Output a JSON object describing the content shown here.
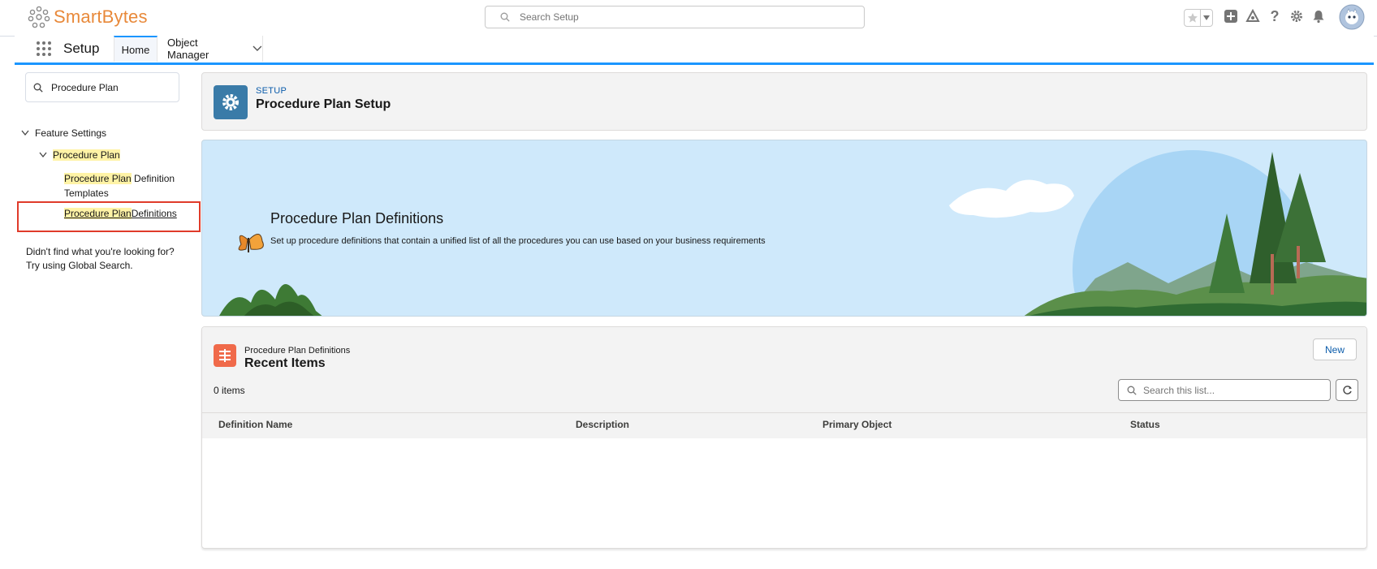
{
  "header": {
    "logo_text": "SmartBytes",
    "search_placeholder": "Search Setup",
    "icons": [
      "star-icon",
      "chevron-down-icon",
      "add-icon",
      "trailhead-icon",
      "help-icon",
      "gear-icon",
      "bell-icon",
      "avatar"
    ]
  },
  "appnav": {
    "app_name": "Setup",
    "tabs": [
      {
        "label": "Home"
      },
      {
        "label": "Object Manager"
      }
    ]
  },
  "sidebar": {
    "quick_find_value": "Procedure Plan",
    "tree": {
      "feature_settings": "Feature Settings",
      "procedure_plan": "Procedure Plan",
      "item1_highlight": "Procedure Plan",
      "item1_rest_line1": " Definition",
      "item1_rest_line2": "Templates",
      "item2_highlight": "Procedure Plan",
      "item2_rest": " Definitions"
    },
    "help_line1": "Didn't find what you're looking for?",
    "help_line2": "Try using Global Search."
  },
  "setup_header": {
    "kicker": "SETUP",
    "title": "Procedure Plan Setup"
  },
  "hero": {
    "title": "Procedure Plan Definitions",
    "description": "Set up procedure definitions that contain a unified list of all the procedures you can use based on your business requirements"
  },
  "list": {
    "kicker": "Procedure Plan Definitions",
    "title": "Recent Items",
    "new_label": "New",
    "count_text": "0 items",
    "search_placeholder": "Search this list...",
    "columns": [
      "Definition Name",
      "Description",
      "Primary Object",
      "Status"
    ],
    "rows": []
  },
  "colors": {
    "accent": "#1b96ff",
    "brand_orange": "#e8893a",
    "highlight": "#fff3a6",
    "red_box": "#e03b2a",
    "setup_icon": "#3a7ba8",
    "list_icon": "#f06a4a"
  }
}
